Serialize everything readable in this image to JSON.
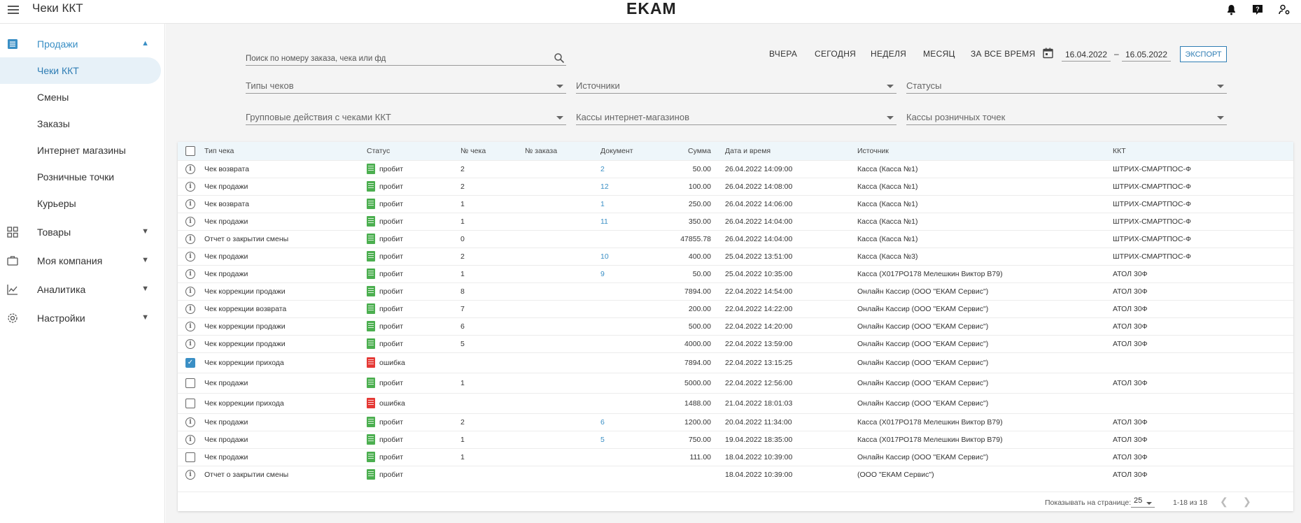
{
  "header": {
    "title": "Чеки ККТ",
    "logo": "EKAM"
  },
  "sidebar": {
    "sales_group": "Продажи",
    "sales_items": [
      "Чеки ККТ",
      "Смены",
      "Заказы",
      "Интернет магазины",
      "Розничные точки",
      "Курьеры"
    ],
    "groups": [
      "Товары",
      "Моя компания",
      "Аналитика",
      "Настройки"
    ]
  },
  "filters": {
    "search_placeholder": "Поиск по номеру заказа, чека или фд",
    "periods": [
      "ВЧЕРА",
      "СЕГОДНЯ",
      "НЕДЕЛЯ",
      "МЕСЯЦ",
      "ЗА ВСЕ ВРЕМЯ"
    ],
    "date_from": "16.04.2022",
    "date_sep": "–",
    "date_to": "16.05.2022",
    "export": "ЭКСПОРТ",
    "receipt_types": "Типы чеков",
    "sources": "Источники",
    "statuses": "Статусы",
    "group_actions": "Групповые действия с чеками ККТ",
    "online_cashes": "Кассы интернет-магазинов",
    "retail_cashes": "Кассы розничных точек"
  },
  "table": {
    "columns": [
      "Тип чека",
      "Статус",
      "№ чека",
      "№ заказа",
      "Документ",
      "Сумма",
      "Дата и время",
      "Источник",
      "ККТ"
    ],
    "rows": [
      {
        "icon": "info",
        "type": "Чек возврата",
        "status": "пробит",
        "ok": true,
        "num": "2",
        "order": "",
        "doc": "2",
        "sum": "50.00",
        "date": "26.04.2022 14:09:00",
        "source": "Касса (Касса №1)",
        "kkt": "ШТРИХ-СМАРТПОС-Ф"
      },
      {
        "icon": "info",
        "type": "Чек продажи",
        "status": "пробит",
        "ok": true,
        "num": "2",
        "order": "",
        "doc": "12",
        "sum": "100.00",
        "date": "26.04.2022 14:08:00",
        "source": "Касса (Касса №1)",
        "kkt": "ШТРИХ-СМАРТПОС-Ф"
      },
      {
        "icon": "info",
        "type": "Чек возврата",
        "status": "пробит",
        "ok": true,
        "num": "1",
        "order": "",
        "doc": "1",
        "sum": "250.00",
        "date": "26.04.2022 14:06:00",
        "source": "Касса (Касса №1)",
        "kkt": "ШТРИХ-СМАРТПОС-Ф"
      },
      {
        "icon": "info",
        "type": "Чек продажи",
        "status": "пробит",
        "ok": true,
        "num": "1",
        "order": "",
        "doc": "11",
        "sum": "350.00",
        "date": "26.04.2022 14:04:00",
        "source": "Касса (Касса №1)",
        "kkt": "ШТРИХ-СМАРТПОС-Ф"
      },
      {
        "icon": "info",
        "type": "Отчет о закрытии смены",
        "status": "пробит",
        "ok": true,
        "num": "0",
        "order": "",
        "doc": "",
        "sum": "47855.78",
        "date": "26.04.2022 14:04:00",
        "source": "Касса (Касса №1)",
        "kkt": "ШТРИХ-СМАРТПОС-Ф"
      },
      {
        "icon": "info",
        "type": "Чек продажи",
        "status": "пробит",
        "ok": true,
        "num": "2",
        "order": "",
        "doc": "10",
        "sum": "400.00",
        "date": "25.04.2022 13:51:00",
        "source": "Касса (Касса №3)",
        "kkt": "ШТРИХ-СМАРТПОС-Ф"
      },
      {
        "icon": "info",
        "type": "Чек продажи",
        "status": "пробит",
        "ok": true,
        "num": "1",
        "order": "",
        "doc": "9",
        "sum": "50.00",
        "date": "25.04.2022 10:35:00",
        "source": "Касса (Х017РО178 Мелешкин Виктор В79)",
        "kkt": "АТОЛ 30Ф"
      },
      {
        "icon": "info",
        "type": "Чек коррекции продажи",
        "status": "пробит",
        "ok": true,
        "num": "8",
        "order": "",
        "doc": "",
        "sum": "7894.00",
        "date": "22.04.2022 14:54:00",
        "source": "Онлайн Кассир (ООО \"ЕКАМ Сервис\")",
        "kkt": "АТОЛ 30Ф"
      },
      {
        "icon": "info",
        "type": "Чек коррекции возврата",
        "status": "пробит",
        "ok": true,
        "num": "7",
        "order": "",
        "doc": "",
        "sum": "200.00",
        "date": "22.04.2022 14:22:00",
        "source": "Онлайн Кассир (ООО \"ЕКАМ Сервис\")",
        "kkt": "АТОЛ 30Ф"
      },
      {
        "icon": "info",
        "type": "Чек коррекции продажи",
        "status": "пробит",
        "ok": true,
        "num": "6",
        "order": "",
        "doc": "",
        "sum": "500.00",
        "date": "22.04.2022 14:20:00",
        "source": "Онлайн Кассир (ООО \"ЕКАМ Сервис\")",
        "kkt": "АТОЛ 30Ф"
      },
      {
        "icon": "info",
        "type": "Чек коррекции продажи",
        "status": "пробит",
        "ok": true,
        "num": "5",
        "order": "",
        "doc": "",
        "sum": "4000.00",
        "date": "22.04.2022 13:59:00",
        "source": "Онлайн Кассир (ООО \"ЕКАМ Сервис\")",
        "kkt": "АТОЛ 30Ф"
      },
      {
        "icon": "checked",
        "type": "Чек коррекции прихода",
        "status": "ошибка",
        "ok": false,
        "num": "",
        "order": "",
        "doc": "",
        "sum": "7894.00",
        "date": "22.04.2022 13:15:25",
        "source": "Онлайн Кассир (ООО \"ЕКАМ Сервис\")",
        "kkt": ""
      },
      {
        "icon": "box",
        "type": "Чек продажи",
        "status": "пробит",
        "ok": true,
        "num": "1",
        "order": "",
        "doc": "",
        "sum": "5000.00",
        "date": "22.04.2022 12:56:00",
        "source": "Онлайн Кассир (ООО \"ЕКАМ Сервис\")",
        "kkt": "АТОЛ 30Ф"
      },
      {
        "icon": "box",
        "type": "Чек коррекции прихода",
        "status": "ошибка",
        "ok": false,
        "num": "",
        "order": "",
        "doc": "",
        "sum": "1488.00",
        "date": "21.04.2022 18:01:03",
        "source": "Онлайн Кассир (ООО \"ЕКАМ Сервис\")",
        "kkt": ""
      },
      {
        "icon": "info",
        "type": "Чек продажи",
        "status": "пробит",
        "ok": true,
        "num": "2",
        "order": "",
        "doc": "6",
        "sum": "1200.00",
        "date": "20.04.2022 11:34:00",
        "source": "Касса (Х017РО178 Мелешкин Виктор В79)",
        "kkt": "АТОЛ 30Ф"
      },
      {
        "icon": "info",
        "type": "Чек продажи",
        "status": "пробит",
        "ok": true,
        "num": "1",
        "order": "",
        "doc": "5",
        "sum": "750.00",
        "date": "19.04.2022 18:35:00",
        "source": "Касса (Х017РО178 Мелешкин Виктор В79)",
        "kkt": "АТОЛ 30Ф"
      },
      {
        "icon": "box",
        "type": "Чек продажи",
        "status": "пробит",
        "ok": true,
        "num": "1",
        "order": "",
        "doc": "",
        "sum": "111.00",
        "date": "18.04.2022 10:39:00",
        "source": "Онлайн Кассир (ООО \"ЕКАМ Сервис\")",
        "kkt": "АТОЛ 30Ф"
      },
      {
        "icon": "info",
        "type": "Отчет о закрытии смены",
        "status": "пробит",
        "ok": true,
        "num": "",
        "order": "",
        "doc": "",
        "sum": "",
        "date": "18.04.2022 10:39:00",
        "source": "(ООО \"ЕКАМ Сервис\")",
        "kkt": "АТОЛ 30Ф"
      }
    ]
  },
  "pager": {
    "label": "Показывать на странице:",
    "per_page": "25",
    "range": "1-18 из 18"
  }
}
